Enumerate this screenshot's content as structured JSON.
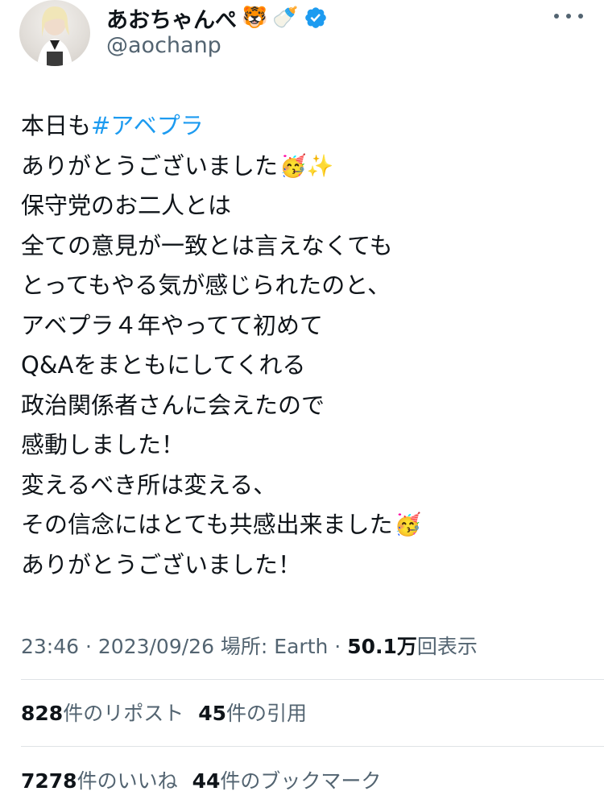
{
  "author": {
    "name": "あおちゃんぺ",
    "name_emojis": [
      "🐯",
      "🍼"
    ],
    "handle": "@aochanp",
    "verified": true
  },
  "tweet": {
    "lines": [
      {
        "text": "本日も ",
        "hashtag": "#アベプラ"
      },
      {
        "text": "ありがとうございました",
        "emoji": "🥳✨"
      },
      {
        "text": "保守党のお二人とは"
      },
      {
        "text": "全ての意見が一致とは言えなくても"
      },
      {
        "text": "とってもやる気が感じられたのと、"
      },
      {
        "text": "アベプラ４年やってて初めて"
      },
      {
        "text": "Q&Aをまともにしてくれる"
      },
      {
        "text": "政治関係者さんに会えたので"
      },
      {
        "text": "感動しました！"
      },
      {
        "text": "変えるべき所は変える、"
      },
      {
        "text": "その信念にはとても共感出来ました",
        "emoji": "🥳"
      },
      {
        "text": "ありがとうございました！"
      }
    ]
  },
  "meta": {
    "time": "23:46",
    "separator": " · ",
    "date": "2023/09/26",
    "location_label": " 場所: Earth",
    "views_count": "50.1万",
    "views_label": "回表示"
  },
  "stats": {
    "reposts_count": "828",
    "reposts_label": "件のリポスト",
    "quotes_count": "45",
    "quotes_label": "件の引用",
    "likes_count": "7278",
    "likes_label": "件のいいね",
    "bookmarks_count": "44",
    "bookmarks_label": "件のブックマーク"
  },
  "colors": {
    "text": "#0f1419",
    "secondary": "#536471",
    "link": "#1d9bf0",
    "verified": "#1d9bf0"
  }
}
